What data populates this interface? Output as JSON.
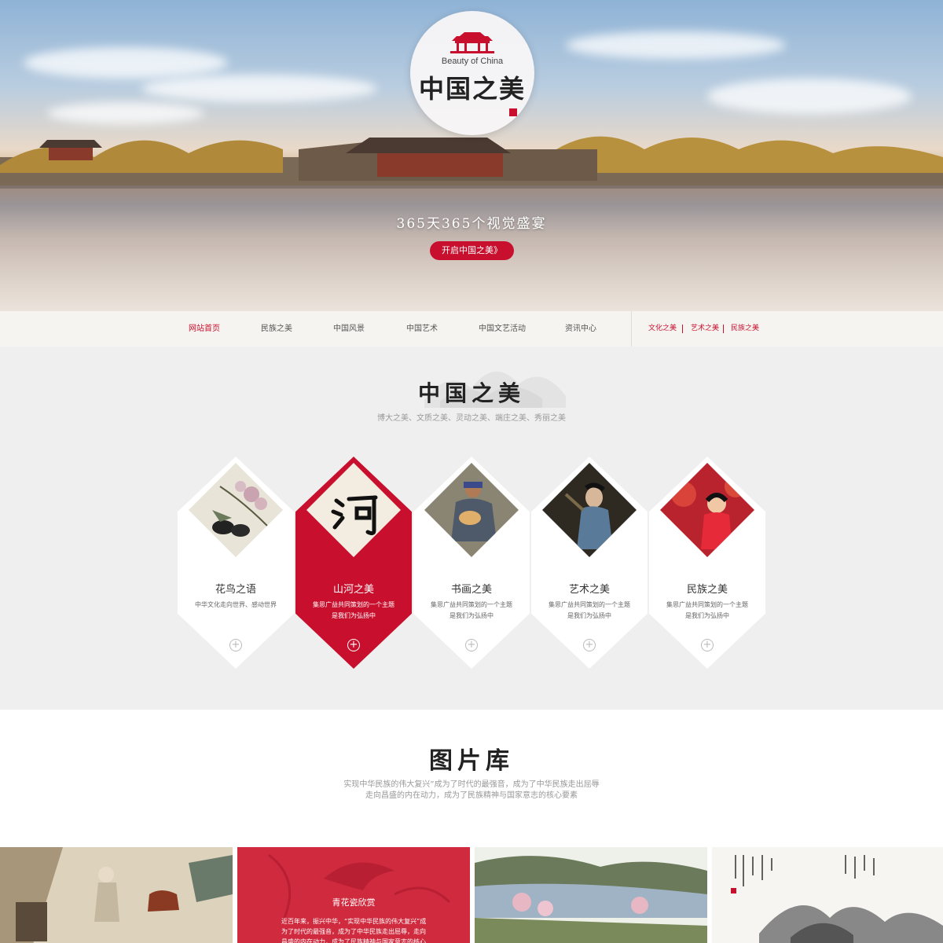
{
  "hero": {
    "logo_en": "Beauty of China",
    "logo_cn": "中国之美",
    "slogan": "365天365个视觉盛宴",
    "cta_label": "开启中国之美》"
  },
  "nav": {
    "items": [
      {
        "label": "网站首页",
        "active": true
      },
      {
        "label": "民族之美",
        "active": false
      },
      {
        "label": "中国风景",
        "active": false
      },
      {
        "label": "中国艺术",
        "active": false
      },
      {
        "label": "中国文艺活动",
        "active": false
      },
      {
        "label": "资讯中心",
        "active": false
      }
    ],
    "sub_links": [
      "文化之美",
      "艺术之美",
      "民族之美"
    ]
  },
  "beauty_section": {
    "title": "中国之美",
    "subtitle": "博大之美、文质之美、灵动之美、端庄之美、秀丽之美",
    "cards": [
      {
        "label": "花鸟之语",
        "desc": "中华文化走向世界、感动世界",
        "icon": "plus-circle-icon"
      },
      {
        "label": "山河之美",
        "desc": "集思广益共同策划的一个主题\n是我们为弘扬中",
        "icon": "plus-circle-icon",
        "active": true
      },
      {
        "label": "书画之美",
        "desc": "集思广益共同策划的一个主题\n是我们为弘扬中",
        "icon": "plus-circle-icon"
      },
      {
        "label": "艺术之美",
        "desc": "集思广益共同策划的一个主题\n是我们为弘扬中",
        "icon": "plus-circle-icon"
      },
      {
        "label": "民族之美",
        "desc": "集思广益共同策划的一个主题\n是我们为弘扬中",
        "icon": "plus-circle-icon"
      }
    ]
  },
  "gallery_section": {
    "title": "图片库",
    "subtitle_line1": "实现中华民族的伟大复兴”成为了时代的最强音，成为了中华民族走出屈辱",
    "subtitle_line2": "走向昌盛的内在动力，成为了民族精神与国家意志的核心要素",
    "featured_title": "青花瓷欣赏",
    "featured_desc": "近百年来，振兴中华，“实现中华民族的伟大复兴”成为了时代的最强音，成为了中华民族走出屈辱，走向昌盛的内在动力，成为了民族精神与国家意志的核心要素"
  },
  "colors": {
    "accent": "#c8102e",
    "section_bg": "#efefef",
    "nav_bg": "#f5f4f1"
  }
}
